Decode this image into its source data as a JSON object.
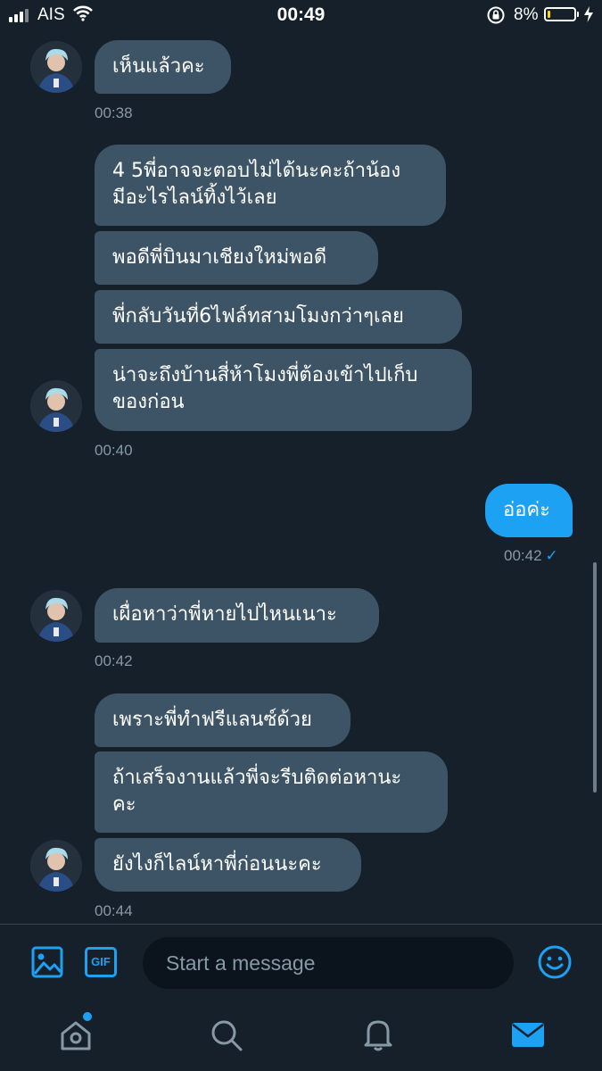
{
  "status_bar": {
    "carrier": "AIS",
    "time": "00:49",
    "battery_percent": "8%",
    "battery_level": 0.08
  },
  "messages": [
    {
      "direction": "in",
      "text": "เห็นแล้วคะ"
    },
    {
      "direction": "in",
      "timestamp": "00:38"
    },
    {
      "direction": "in",
      "text": "4 5พี่อาจจะตอบไม่ได้นะคะถ้าน้อง\nมีอะไรไลน์ทิ้งไว้เลย"
    },
    {
      "direction": "in",
      "text": "พอดีพี่บินมาเชียงใหม่พอดี"
    },
    {
      "direction": "in",
      "text": "พี่กลับวันที่6ไฟล์ทสามโมงกว่าๆเลย"
    },
    {
      "direction": "in",
      "text": "น่าจะถึงบ้านสี่ห้าโมงพี่ต้องเข้าไปเก็บ\nของก่อน"
    },
    {
      "direction": "in",
      "timestamp": "00:40"
    },
    {
      "direction": "out",
      "text": "อ่อค่ะ"
    },
    {
      "direction": "out",
      "timestamp": "00:42"
    },
    {
      "direction": "in",
      "text": "เผื่อหาว่าพี่หายไปไหนเนาะ"
    },
    {
      "direction": "in",
      "timestamp": "00:42"
    },
    {
      "direction": "in",
      "text": "เพราะพี่ทำฟรีแลนซ์ด้วย"
    },
    {
      "direction": "in",
      "text": "ถ้าเสร็จงานแล้วพี่จะรีบติดต่อหานะ\nคะ"
    },
    {
      "direction": "in",
      "text": "ยังไงก็ไลน์หาพี่ก่อนนะคะ"
    },
    {
      "direction": "in",
      "timestamp": "00:44"
    }
  ],
  "composer": {
    "placeholder": "Start a message",
    "gif_label": "GIF"
  },
  "tabs": [
    "home",
    "search",
    "notifications",
    "messages"
  ],
  "colors": {
    "background": "#15202b",
    "incoming_bubble": "#3d5466",
    "outgoing_bubble": "#1da1f2",
    "accent": "#1da1f2",
    "muted_text": "#8899a6"
  },
  "icons": [
    "signal-icon",
    "wifi-icon",
    "rotation-lock-icon",
    "battery-icon",
    "charging-icon",
    "image-icon",
    "gif-icon",
    "emoji-icon",
    "home-icon",
    "search-icon",
    "bell-icon",
    "mail-icon"
  ]
}
